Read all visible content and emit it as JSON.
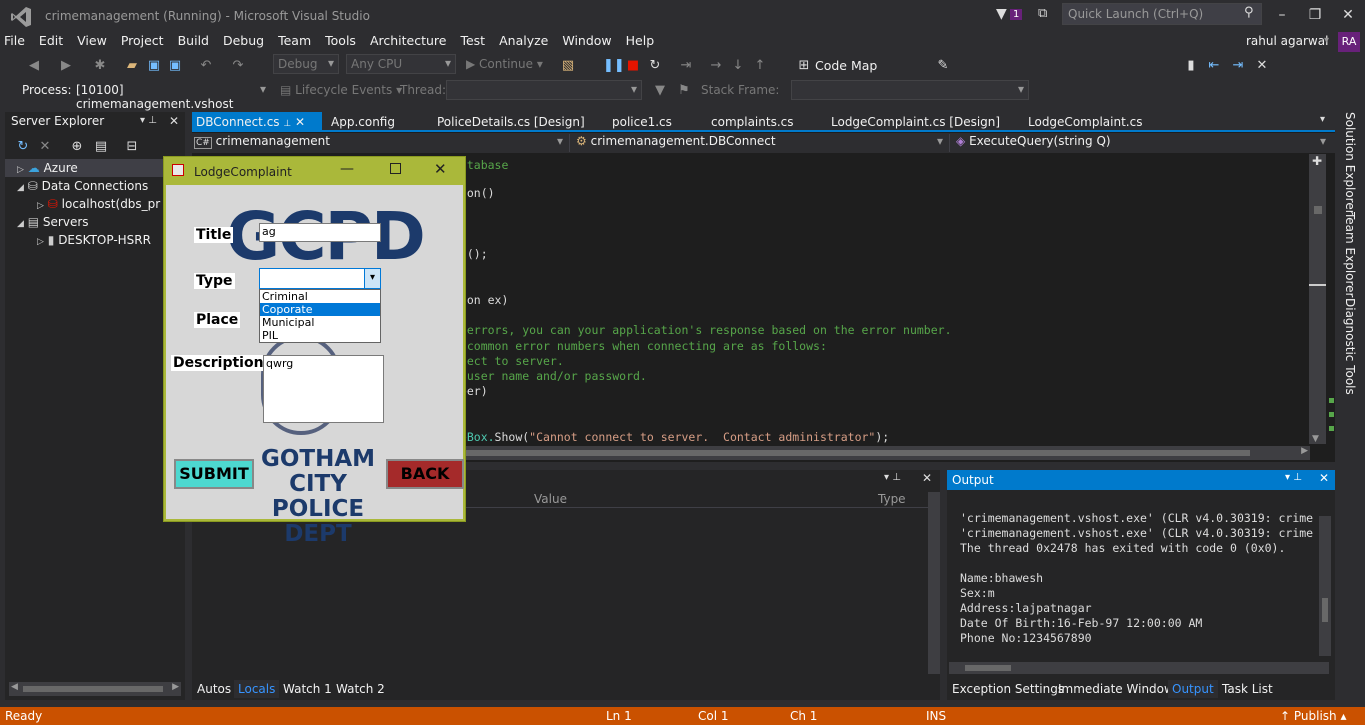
{
  "window": {
    "title": "crimemanagement (Running) - Microsoft Visual Studio",
    "notif_count": "1",
    "quick_launch": "Quick Launch (Ctrl+Q)",
    "user": "rahul agarwal",
    "initials": "RA"
  },
  "menu": [
    "File",
    "Edit",
    "View",
    "Project",
    "Build",
    "Debug",
    "Team",
    "Tools",
    "Architecture",
    "Test",
    "Analyze",
    "Window",
    "Help"
  ],
  "toolbar": {
    "config": "Debug",
    "platform": "Any CPU",
    "continue": "Continue",
    "code_map": "Code Map",
    "process_label": "Process:",
    "process_value": "[10100] crimemanagement.vshost",
    "lifecycle": "Lifecycle Events",
    "thread": "Thread:",
    "stack_frame": "Stack Frame:"
  },
  "server_explorer": {
    "title": "Server Explorer",
    "items": [
      "Azure",
      "Data Connections",
      "localhost(dbs_pr",
      "Servers",
      "DESKTOP-HSRR"
    ]
  },
  "doc_tabs": [
    "DBConnect.cs",
    "App.config",
    "PoliceDetails.cs [Design]",
    "police1.cs",
    "complaints.cs",
    "LodgeComplaint.cs [Design]",
    "LodgeComplaint.cs"
  ],
  "nav": {
    "project": "crimemanagement",
    "class": "crimemanagement.DBConnect",
    "method": "ExecuteQuery(string Q)"
  },
  "code_lines": [
    {
      "cls": "cm",
      "text": "database"
    },
    {
      "cls": "",
      "text": "tion()"
    },
    {
      "cls": "",
      "text": "en();"
    },
    {
      "cls": "",
      "text": "tion ex)"
    },
    {
      "cls": "cm",
      "text": "g errors, you can your application's response based on the error number."
    },
    {
      "cls": "cm",
      "text": "t common error numbers when connecting are as follows:"
    },
    {
      "cls": "cm",
      "text": "nnect to server."
    },
    {
      "cls": "cm",
      "text": "d user name and/or password."
    },
    {
      "cls": "",
      "text": "mber)"
    }
  ],
  "code_last": {
    "a": "geBox.",
    "b": "Show(",
    "c": "\"Cannot connect to server.  Contact administrator\"",
    "d": ");"
  },
  "locals": {
    "col_value": "Value",
    "col_type": "Type",
    "tabs": [
      "Autos",
      "Locals",
      "Watch 1",
      "Watch 2"
    ]
  },
  "output": {
    "title": "Output",
    "lines": [
      "'crimemanagement.vshost.exe' (CLR v4.0.30319: crime",
      "'crimemanagement.vshost.exe' (CLR v4.0.30319: crime",
      "The thread 0x2478 has exited with code 0 (0x0).",
      "",
      "Name:bhawesh",
      "Sex:m",
      "Address:lajpatnagar",
      "Date Of Birth:16-Feb-97 12:00:00 AM",
      "Phone No:1234567890"
    ],
    "tabs": [
      "Exception Settings",
      "Immediate Window",
      "Output",
      "Task List"
    ]
  },
  "right_tabs": [
    "Solution Explorer",
    "Team Explorer",
    "Diagnostic Tools"
  ],
  "status": {
    "ready": "Ready",
    "ln": "Ln 1",
    "col": "Col 1",
    "ch": "Ch 1",
    "ins": "INS",
    "publish": "Publish"
  },
  "dialog": {
    "title": "LodgeComplaint",
    "logo_top": "GCPD",
    "logo_bottom1": "GOTHAM CITY",
    "logo_bottom2": "POLICE DEPT",
    "title_label": "Title",
    "title_value": "ag",
    "type_label": "Type",
    "type_options": [
      "Criminal",
      "Coporate",
      "Municipal",
      "PIL"
    ],
    "selected_option": "Coporate",
    "place_label": "Place",
    "desc_label": "Description",
    "desc_value": "qwrg",
    "submit": "SUBMIT",
    "back": "BACK"
  },
  "colors": {
    "accent": "#007acc",
    "status": "#ca5100",
    "dialog_frame": "#aab83a",
    "submit_bg": "#4dd8d0",
    "back_bg": "#a52a2a"
  }
}
